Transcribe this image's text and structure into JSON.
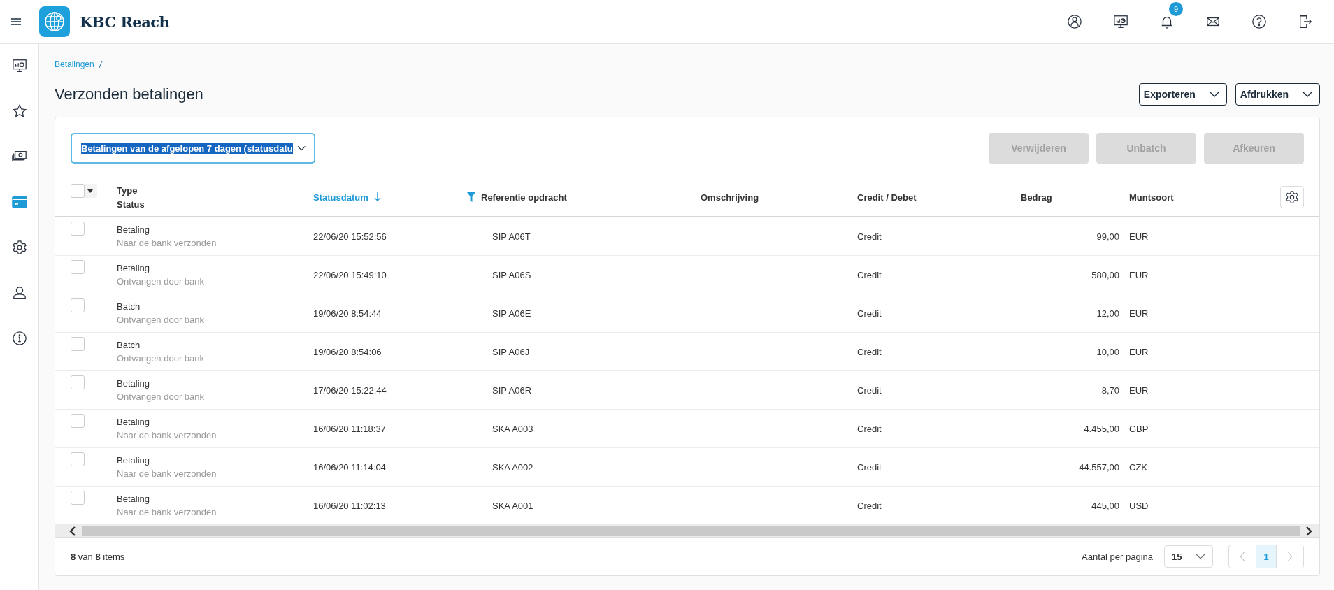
{
  "app": {
    "title": "KBC Reach"
  },
  "topbar_icons": [
    {
      "kind": "user"
    },
    {
      "kind": "dashboard"
    },
    {
      "kind": "bell",
      "badge": "9"
    },
    {
      "kind": "mail"
    },
    {
      "kind": "help"
    },
    {
      "kind": "logout"
    }
  ],
  "sidebar": {
    "items": [
      {
        "kind": "dashboard",
        "selected": false
      },
      {
        "kind": "star",
        "selected": false
      },
      {
        "kind": "money",
        "selected": false
      },
      {
        "kind": "card",
        "selected": true
      },
      {
        "kind": "gear",
        "selected": false
      },
      {
        "kind": "user",
        "selected": false
      },
      {
        "kind": "info",
        "selected": false
      }
    ]
  },
  "breadcrumb": [
    "Betalingen"
  ],
  "page_title": "Verzonden betalingen",
  "header_buttons": [
    "Exporteren",
    "Afdrukken"
  ],
  "filter": {
    "value": "Betalingen van de afgelopen 7 dagen (statusdatu"
  },
  "actions": [
    {
      "label": "Verwijderen",
      "disabled": true
    },
    {
      "label": "Unbatch",
      "disabled": true
    },
    {
      "label": "Afkeuren",
      "disabled": true
    }
  ],
  "table": {
    "columns": [
      {
        "label": "Type",
        "sublabel": "Status",
        "sorted": false,
        "filtered": false
      },
      {
        "label": "Statusdatum",
        "sorted": true,
        "filtered": false
      },
      {
        "label": "Referentie opdracht",
        "sorted": false,
        "filtered": true
      },
      {
        "label": "Omschrijving",
        "sorted": false,
        "filtered": false
      },
      {
        "label": "Credit / Debet",
        "sorted": false,
        "filtered": false
      },
      {
        "label": "Bedrag",
        "sorted": false,
        "filtered": false
      },
      {
        "label": "Muntsoort",
        "sorted": false,
        "filtered": false
      }
    ],
    "rows": [
      {
        "checked": false,
        "type": "Betaling",
        "status": "Naar de bank verzonden",
        "date": "22/06/20 15:52:56",
        "reference": "SIP A06T",
        "credit_debit": "Credit",
        "amount": "99,00",
        "currency": "EUR"
      },
      {
        "checked": false,
        "type": "Betaling",
        "status": "Ontvangen door bank",
        "date": "22/06/20 15:49:10",
        "reference": "SIP A06S",
        "credit_debit": "Credit",
        "amount": "580,00",
        "currency": "EUR"
      },
      {
        "checked": false,
        "type": "Batch",
        "status": "Ontvangen door bank",
        "date": "19/06/20 8:54:44",
        "reference": "SIP A06E",
        "credit_debit": "Credit",
        "amount": "12,00",
        "currency": "EUR"
      },
      {
        "checked": false,
        "type": "Batch",
        "status": "Ontvangen door bank",
        "date": "19/06/20 8:54:06",
        "reference": "SIP A06J",
        "credit_debit": "Credit",
        "amount": "10,00",
        "currency": "EUR"
      },
      {
        "checked": false,
        "type": "Betaling",
        "status": "Ontvangen door bank",
        "date": "17/06/20 15:22:44",
        "reference": "SIP A06R",
        "credit_debit": "Credit",
        "amount": "8,70",
        "currency": "EUR"
      },
      {
        "checked": false,
        "type": "Betaling",
        "status": "Naar de bank verzonden",
        "date": "16/06/20 11:18:37",
        "reference": "SKA A003",
        "credit_debit": "Credit",
        "amount": "4.455,00",
        "currency": "GBP"
      },
      {
        "checked": false,
        "type": "Betaling",
        "status": "Naar de bank verzonden",
        "date": "16/06/20 11:14:04",
        "reference": "SKA A002",
        "credit_debit": "Credit",
        "amount": "44.557,00",
        "currency": "CZK"
      },
      {
        "checked": false,
        "type": "Betaling",
        "status": "Naar de bank verzonden",
        "date": "16/06/20 11:02:13",
        "reference": "SKA A001",
        "credit_debit": "Credit",
        "amount": "445,00",
        "currency": "USD"
      }
    ]
  },
  "footer": {
    "count": "**8** van **8** items",
    "per_page_label": "Aantal per pagina",
    "per_page": "15",
    "pages": [
      {
        "label": "1",
        "selected": true
      }
    ]
  }
}
